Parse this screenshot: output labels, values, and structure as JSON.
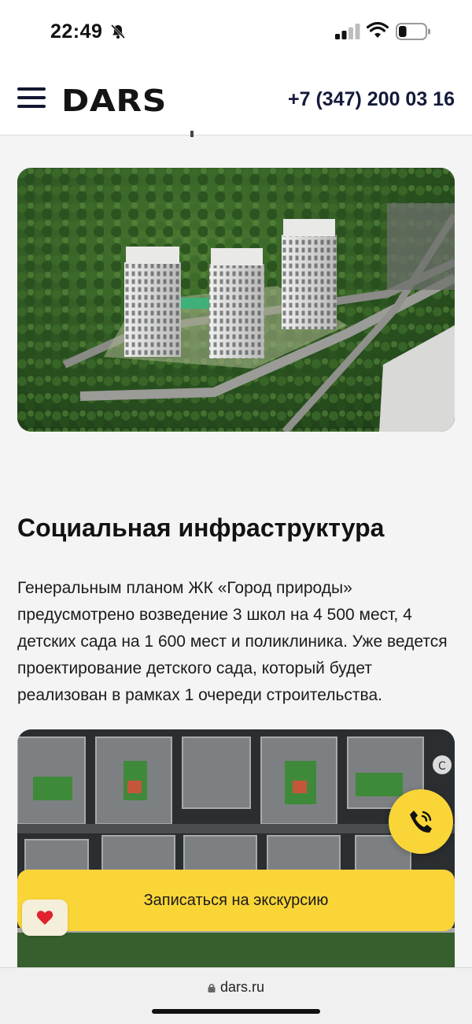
{
  "status_bar": {
    "time": "22:49",
    "battery_level": 0.3
  },
  "header": {
    "logo": "DARS",
    "phone": "+7 (347) 200 03 16"
  },
  "images": {
    "aerial_alt": "aerial-render-three-towers",
    "plan_alt": "district-master-plan"
  },
  "section": {
    "title": "Социальная инфраструктура",
    "paragraph": "Генеральным планом ЖК «Город природы» предусмотрено возведение 3 школ на 4 500 мест, 4 детских сада на 1 600 мест и поликлиника. Уже ведется проектирование детского сада, который будет реализован в рамках 1 очереди строительства."
  },
  "actions": {
    "excursion_label": "Записаться на экскурсию"
  },
  "browser": {
    "url": "dars.ru"
  },
  "colors": {
    "accent": "#f9d538",
    "navy": "#141a3a",
    "favorite": "#e0232e"
  }
}
